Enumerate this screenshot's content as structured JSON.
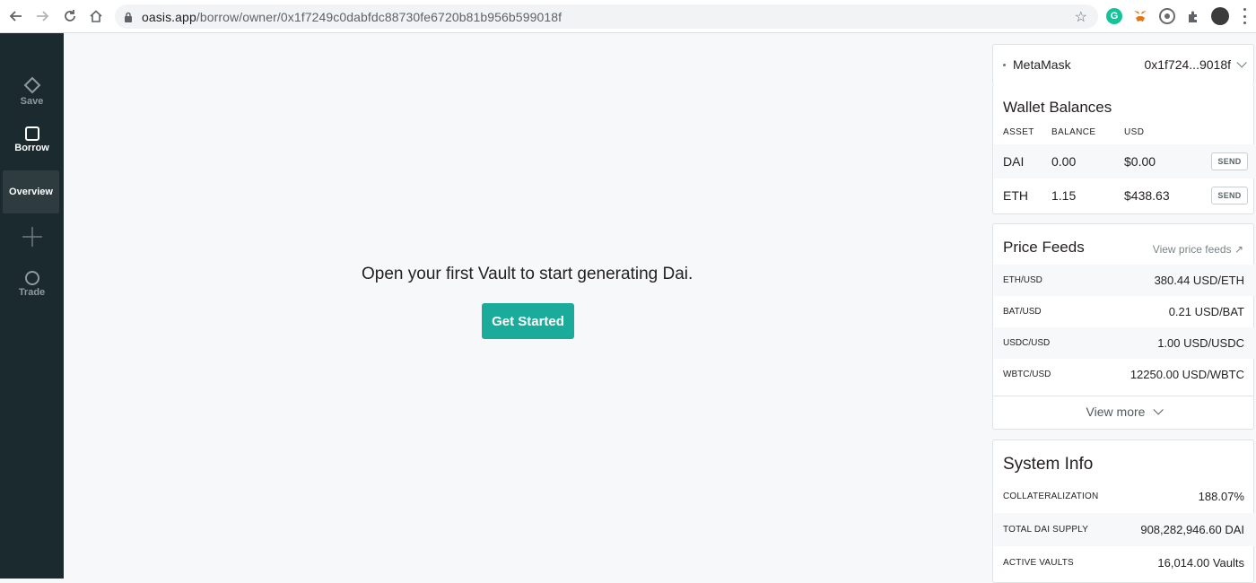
{
  "browser": {
    "url_host": "oasis.app",
    "url_path": "/borrow/owner/0x1f7249c0dabfdc88730fe6720b81b956b599018f"
  },
  "sidebar": {
    "items": [
      {
        "label": "Save",
        "icon": "diamond-icon"
      },
      {
        "label": "Borrow",
        "icon": "square-icon"
      },
      {
        "label": "Overview"
      },
      {
        "label": "",
        "icon": "plus-icon"
      },
      {
        "label": "Trade",
        "icon": "circle-icon"
      }
    ]
  },
  "main": {
    "message": "Open your first Vault to start generating Dai.",
    "cta_label": "Get Started"
  },
  "wallet": {
    "provider": "MetaMask",
    "address": "0x1f724...9018f"
  },
  "balances": {
    "title": "Wallet Balances",
    "columns": [
      "ASSET",
      "BALANCE",
      "USD"
    ],
    "rows": [
      {
        "asset": "DAI",
        "balance": "0.00",
        "usd": "$0.00",
        "action": "SEND"
      },
      {
        "asset": "ETH",
        "balance": "1.15",
        "usd": "$438.63",
        "action": "SEND"
      }
    ]
  },
  "price_feeds": {
    "title": "Price Feeds",
    "link": "View price feeds ↗",
    "rows": [
      {
        "pair": "ETH/USD",
        "value": "380.44 USD/ETH"
      },
      {
        "pair": "BAT/USD",
        "value": "0.21 USD/BAT"
      },
      {
        "pair": "USDC/USD",
        "value": "1.00 USD/USDC"
      },
      {
        "pair": "WBTC/USD",
        "value": "12250.00 USD/WBTC"
      }
    ],
    "view_more": "View more"
  },
  "system_info": {
    "title": "System Info",
    "rows": [
      {
        "key": "COLLATERALIZATION",
        "value": "188.07%"
      },
      {
        "key": "TOTAL DAI SUPPLY",
        "value": "908,282,946.60 DAI"
      },
      {
        "key": "ACTIVE VAULTS",
        "value": "16,014.00 Vaults"
      }
    ]
  }
}
